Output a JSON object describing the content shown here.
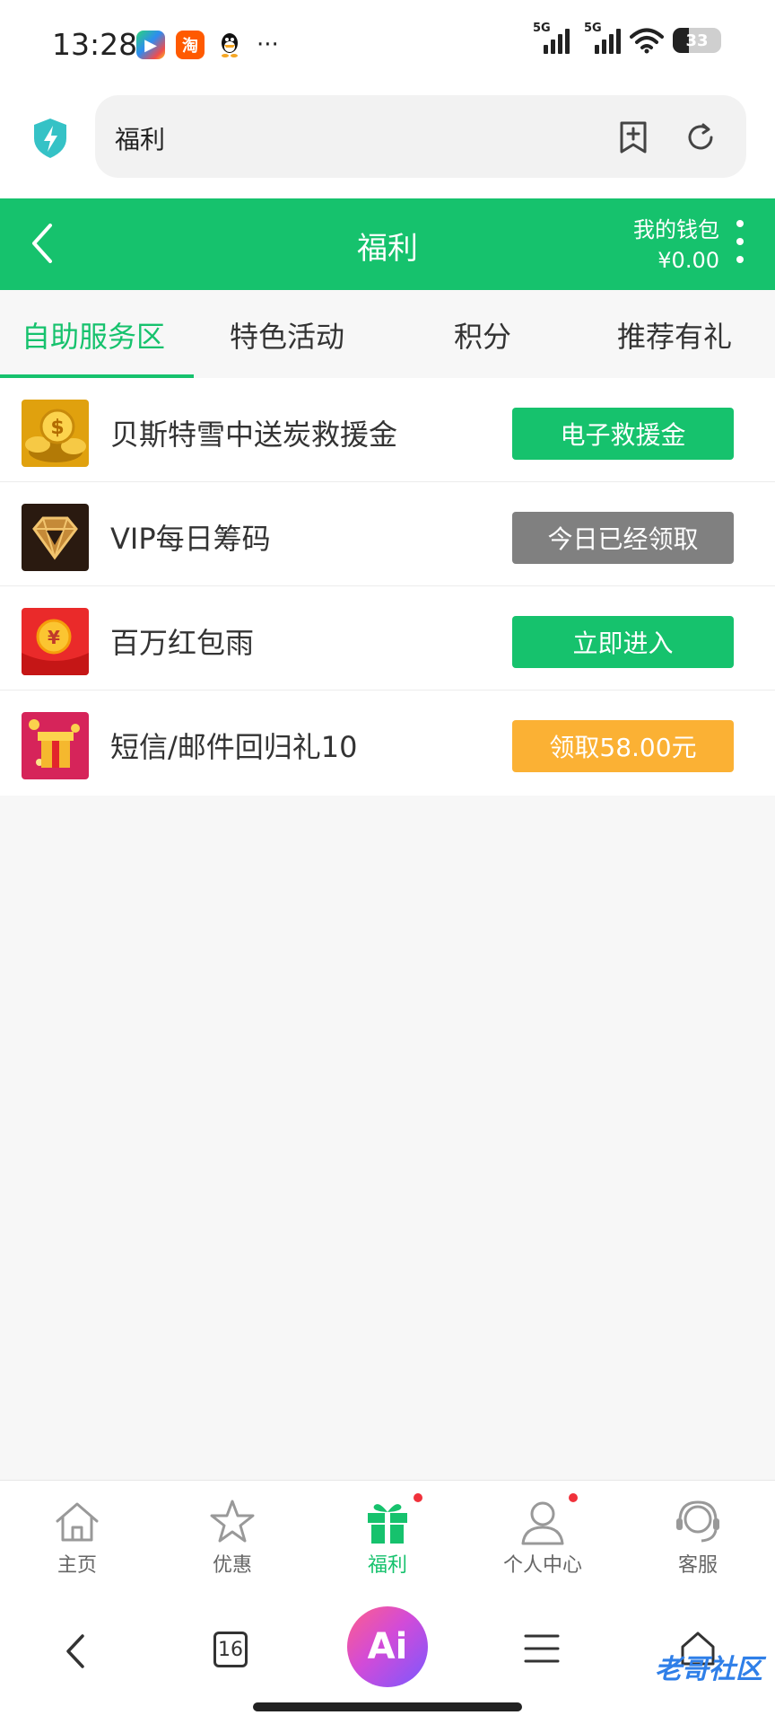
{
  "status_bar": {
    "time": "13:28",
    "signal_1": "5G",
    "signal_2": "5G",
    "battery": "33"
  },
  "browser": {
    "url_text": "福利"
  },
  "header": {
    "title": "福利",
    "wallet_label": "我的钱包",
    "wallet_amount": "¥0.00"
  },
  "tabs": [
    {
      "label": "自助服务区",
      "active": true
    },
    {
      "label": "特色活动",
      "active": false
    },
    {
      "label": "积分",
      "active": false
    },
    {
      "label": "推荐有礼",
      "active": false
    }
  ],
  "items": [
    {
      "title": "贝斯特雪中送炭救援金",
      "button": "电子救援金",
      "button_color": "#16c26d",
      "icon": "gold-coins-icon"
    },
    {
      "title": "VIP每日筹码",
      "button": "今日已经领取",
      "button_color": "#808080",
      "icon": "vip-diamond-icon"
    },
    {
      "title": "百万红包雨",
      "button": "立即进入",
      "button_color": "#16c26d",
      "icon": "red-envelope-icon"
    },
    {
      "title": "短信/邮件回归礼10",
      "button": "领取58.00元",
      "button_color": "#fbb134",
      "icon": "gift-box-icon"
    }
  ],
  "bottom_nav": [
    {
      "label": "主页",
      "icon": "home-icon"
    },
    {
      "label": "优惠",
      "icon": "star-icon"
    },
    {
      "label": "福利",
      "icon": "gift-icon",
      "active": true
    },
    {
      "label": "个人中心",
      "icon": "user-icon"
    },
    {
      "label": "客服",
      "icon": "headset-icon"
    }
  ],
  "system_nav": {
    "tab_count": "16",
    "ai_label": "Ai",
    "watermark": "老哥社区"
  },
  "colors": {
    "accent": "#16c26d",
    "disabled": "#808080",
    "highlight": "#fbb134",
    "notification": "#f0313b"
  }
}
